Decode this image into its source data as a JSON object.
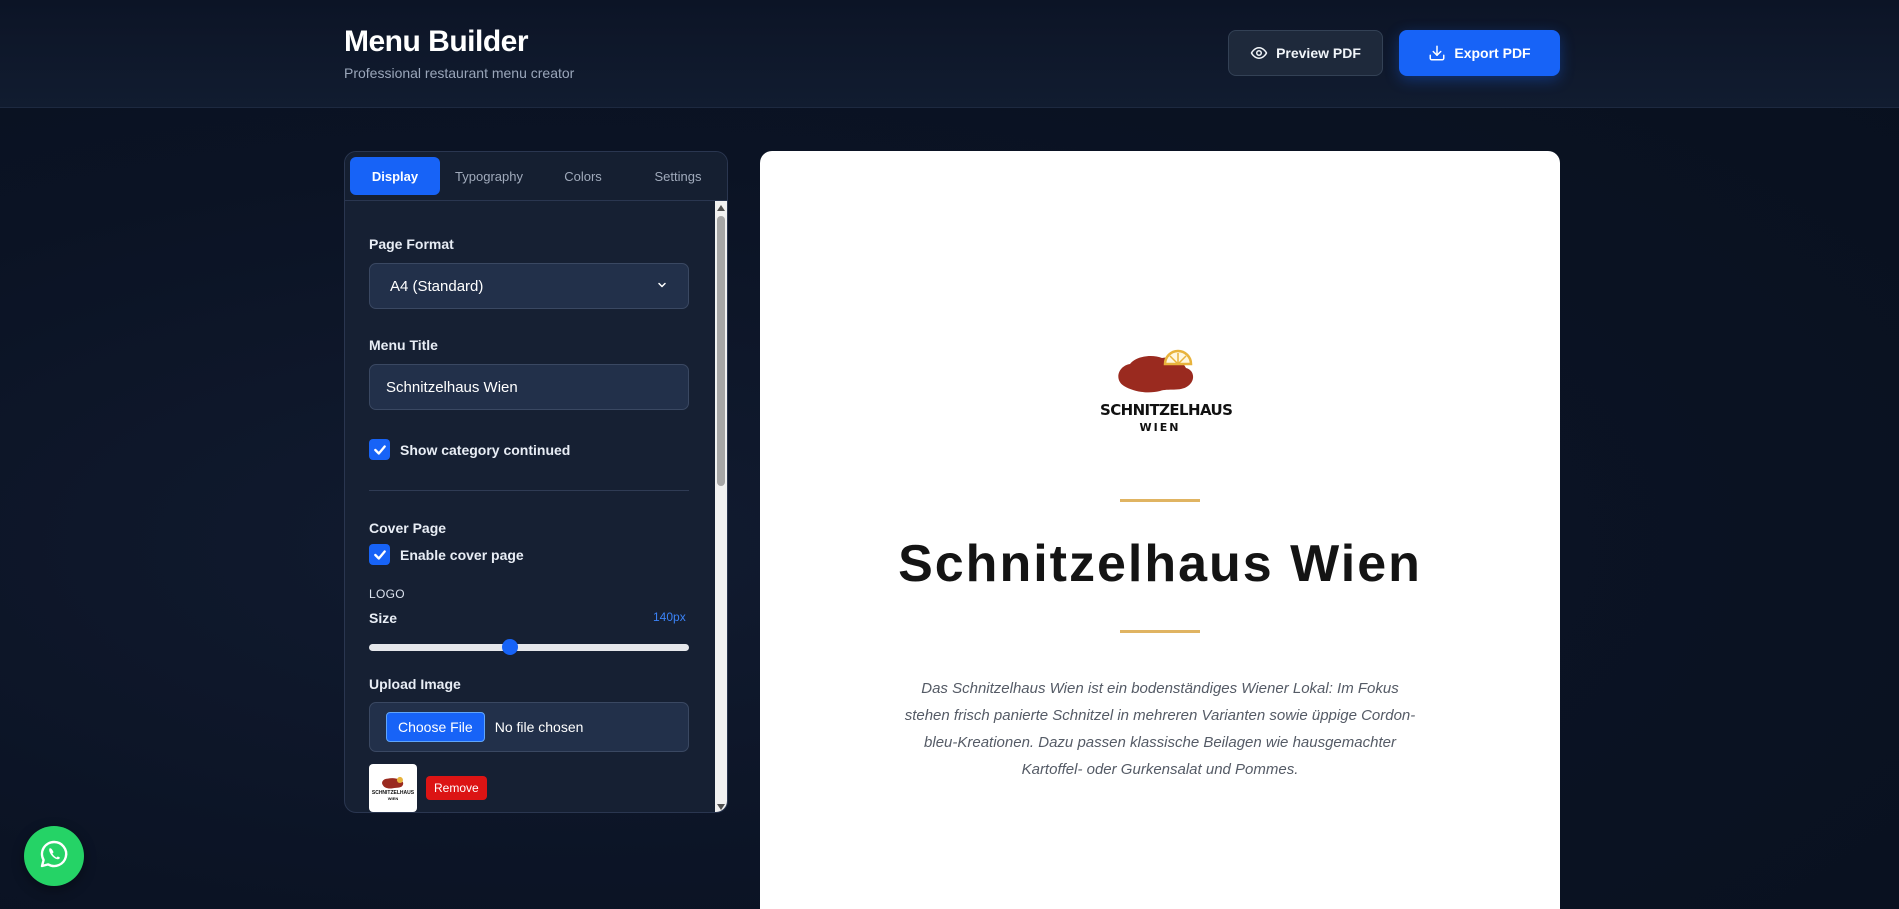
{
  "header": {
    "title": "Menu Builder",
    "subtitle": "Professional restaurant menu creator",
    "preview_label": "Preview PDF",
    "export_label": "Export PDF"
  },
  "tabs": [
    {
      "label": "Display",
      "active": true
    },
    {
      "label": "Typography",
      "active": false
    },
    {
      "label": "Colors",
      "active": false
    },
    {
      "label": "Settings",
      "active": false
    }
  ],
  "display": {
    "page_format_label": "Page Format",
    "page_format_value": "A4 (Standard)",
    "menu_title_label": "Menu Title",
    "menu_title_value": "Schnitzelhaus Wien",
    "show_category_continued_label": "Show category continued",
    "show_category_continued": true,
    "cover_page_label": "Cover Page",
    "enable_cover_page_label": "Enable cover page",
    "enable_cover_page": true,
    "logo_section_label": "LOGO",
    "size_label": "Size",
    "size_value": "140px",
    "size_fraction": 0.44,
    "upload_image_label": "Upload Image",
    "choose_file_label": "Choose File",
    "no_file_label": "No file chosen",
    "remove_label": "Remove"
  },
  "preview": {
    "logo_name": "SCHNITZELHAUS",
    "logo_sub": "WIEN",
    "title": "Schnitzelhaus Wien",
    "description": "Das Schnitzelhaus Wien ist ein bodenständiges Wiener Lokal: Im Fokus stehen frisch panierte Schnitzel in mehreren Varianten sowie üppige Cordon-bleu-Kreationen. Dazu passen klassische Beilagen wie hausgemachter Kartoffel- oder Gurkensalat und Pommes.",
    "accent_color": "#e0b462"
  },
  "colors": {
    "primary": "#1763f7",
    "danger": "#dc1414",
    "whatsapp": "#25d366"
  }
}
